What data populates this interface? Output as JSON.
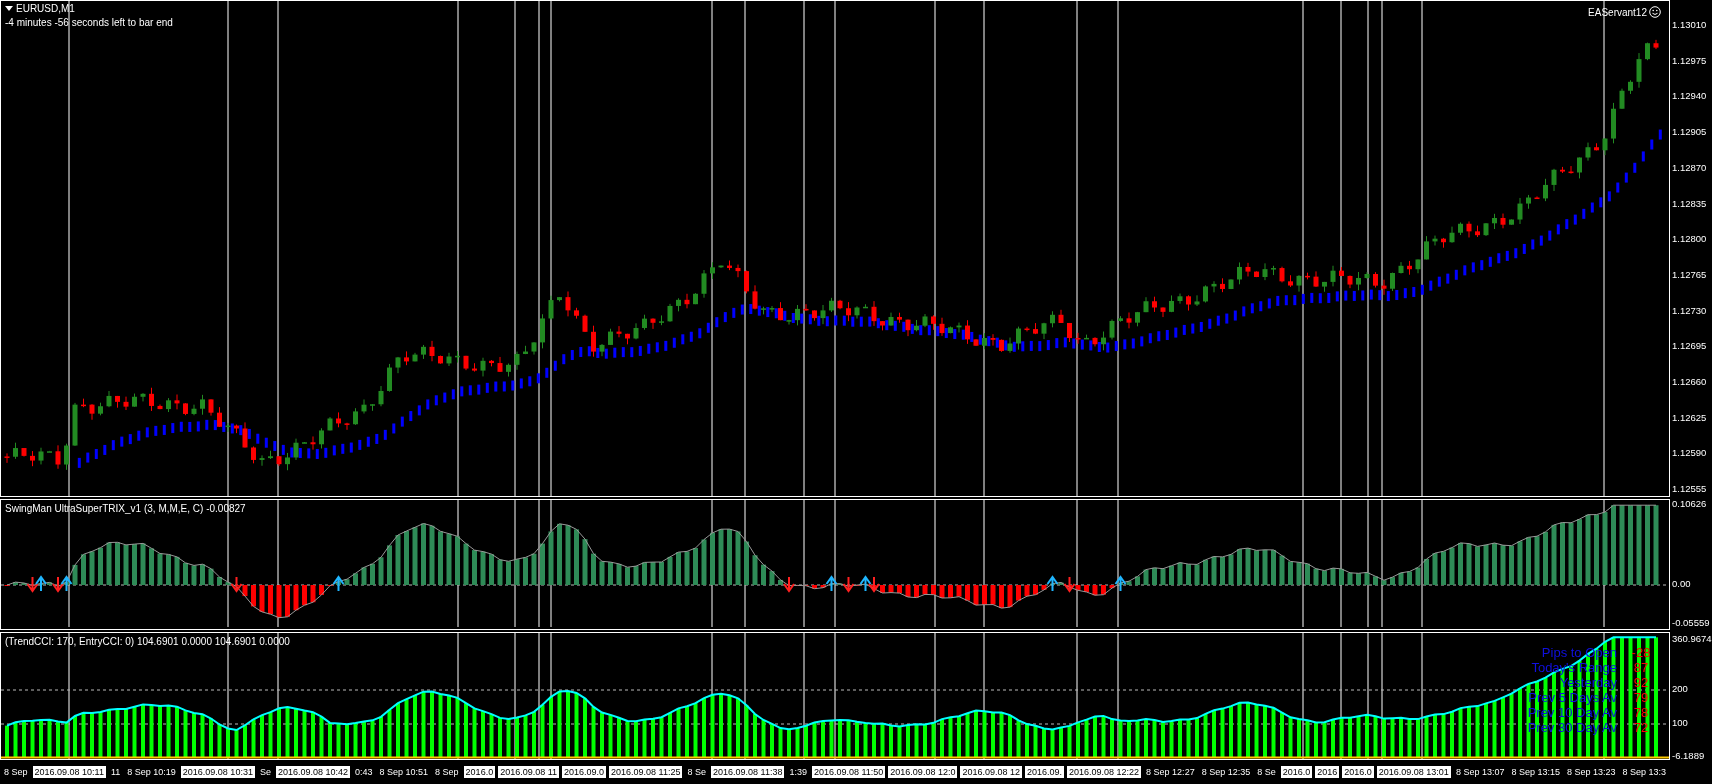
{
  "main_chart": {
    "symbol": "EURUSD,M1",
    "countdown": "-4 minutes -56 seconds left to bar end",
    "expert": "EAServant12",
    "price_axis": [
      "1.13010",
      "1.12975",
      "1.12940",
      "1.12905",
      "1.12870",
      "1.12835",
      "1.12800",
      "1.12765",
      "1.12730",
      "1.12695",
      "1.12660",
      "1.12625",
      "1.12590",
      "1.12555"
    ]
  },
  "trix_panel": {
    "label": "SwingMan UltraSuperTRIX_v1 (3, M,M,E, C) -0.00827",
    "axis": [
      "0.10626",
      "0.00",
      "-0.05559"
    ]
  },
  "cci_panel": {
    "label": "(TrendCCI: 170, EntryCCI: 0) 104.6901 0.0000 104.6901 0.0000",
    "axis": [
      "360.9674",
      "200",
      "100",
      "-6.1889"
    ],
    "stats": [
      {
        "label": "Pips to Open",
        "value": "-28"
      },
      {
        "label": "Today's Range",
        "value": "87"
      },
      {
        "label": "Yesterday",
        "value": "92"
      },
      {
        "label": "Prev 5 Days Av",
        "value": "79"
      },
      {
        "label": "Prev 10 Day Av",
        "value": "78"
      },
      {
        "label": "Prev 30 Day Av",
        "value": "72"
      }
    ]
  },
  "time_axis": [
    {
      "label": "8 Sep",
      "highlighted": false
    },
    {
      "label": "2016.09.08 10:11",
      "highlighted": true
    },
    {
      "label": "11",
      "highlighted": false
    },
    {
      "label": "8 Sep 10:19",
      "highlighted": false
    },
    {
      "label": "2016.09.08 10:31",
      "highlighted": true
    },
    {
      "label": "Se",
      "highlighted": false
    },
    {
      "label": "2016.09.08 10:42",
      "highlighted": true
    },
    {
      "label": "0:43",
      "highlighted": false
    },
    {
      "label": "8 Sep 10:51",
      "highlighted": false
    },
    {
      "label": "8 Sep",
      "highlighted": false
    },
    {
      "label": "2016.0",
      "highlighted": true
    },
    {
      "label": "2016.09.08 11",
      "highlighted": true
    },
    {
      "label": "2016.09.0",
      "highlighted": true
    },
    {
      "label": "2016.09.08 11:25",
      "highlighted": true
    },
    {
      "label": "8 Se",
      "highlighted": false
    },
    {
      "label": "2016.09.08 11:38",
      "highlighted": true
    },
    {
      "label": "1:39",
      "highlighted": false
    },
    {
      "label": "2016.09.08 11:50",
      "highlighted": true
    },
    {
      "label": "2016.09.08 12:0",
      "highlighted": true
    },
    {
      "label": "2016.09.08 12",
      "highlighted": true
    },
    {
      "label": "2016.09.",
      "highlighted": true
    },
    {
      "label": "2016.09.08 12:22",
      "highlighted": true
    },
    {
      "label": "8 Sep 12:27",
      "highlighted": false
    },
    {
      "label": "8 Sep 12:35",
      "highlighted": false
    },
    {
      "label": "8 Se",
      "highlighted": false
    },
    {
      "label": "2016.0",
      "highlighted": true
    },
    {
      "label": "2016",
      "highlighted": true
    },
    {
      "label": "2016.0",
      "highlighted": true
    },
    {
      "label": "2016.09.08 13:01",
      "highlighted": true
    },
    {
      "label": "8 Sep 13:07",
      "highlighted": false
    },
    {
      "label": "8 Sep 13:15",
      "highlighted": false
    },
    {
      "label": "8 Sep 13:23",
      "highlighted": false
    },
    {
      "label": "8 Sep 13:3",
      "highlighted": false
    }
  ]
}
